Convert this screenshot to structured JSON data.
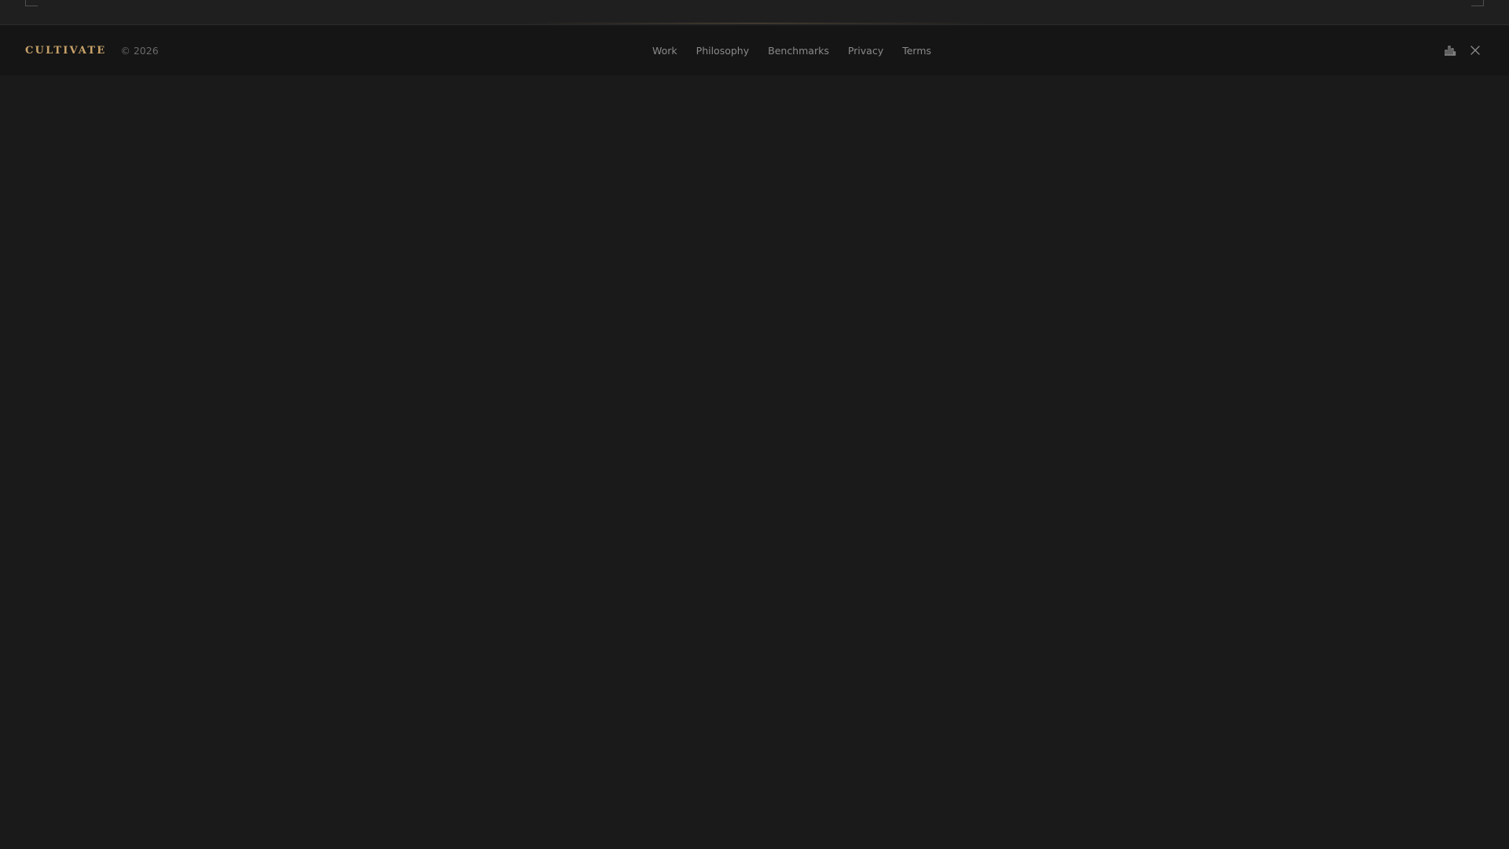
{
  "brand": {
    "name": "CULTIVATE",
    "copyright": "© 2026",
    "accent_color": "#c9a36a"
  },
  "nav": {
    "items": [
      {
        "label": "Work"
      },
      {
        "label": "Philosophy"
      },
      {
        "label": "Benchmarks"
      },
      {
        "label": "Privacy"
      },
      {
        "label": "Terms"
      }
    ]
  },
  "actions": {
    "icons": [
      "chart-icon",
      "close-icon"
    ]
  },
  "colors": {
    "background": "#1a1a1a",
    "footer_background": "#151515",
    "nav_text": "#8a8a8a",
    "muted_text": "#6a6a6a"
  }
}
